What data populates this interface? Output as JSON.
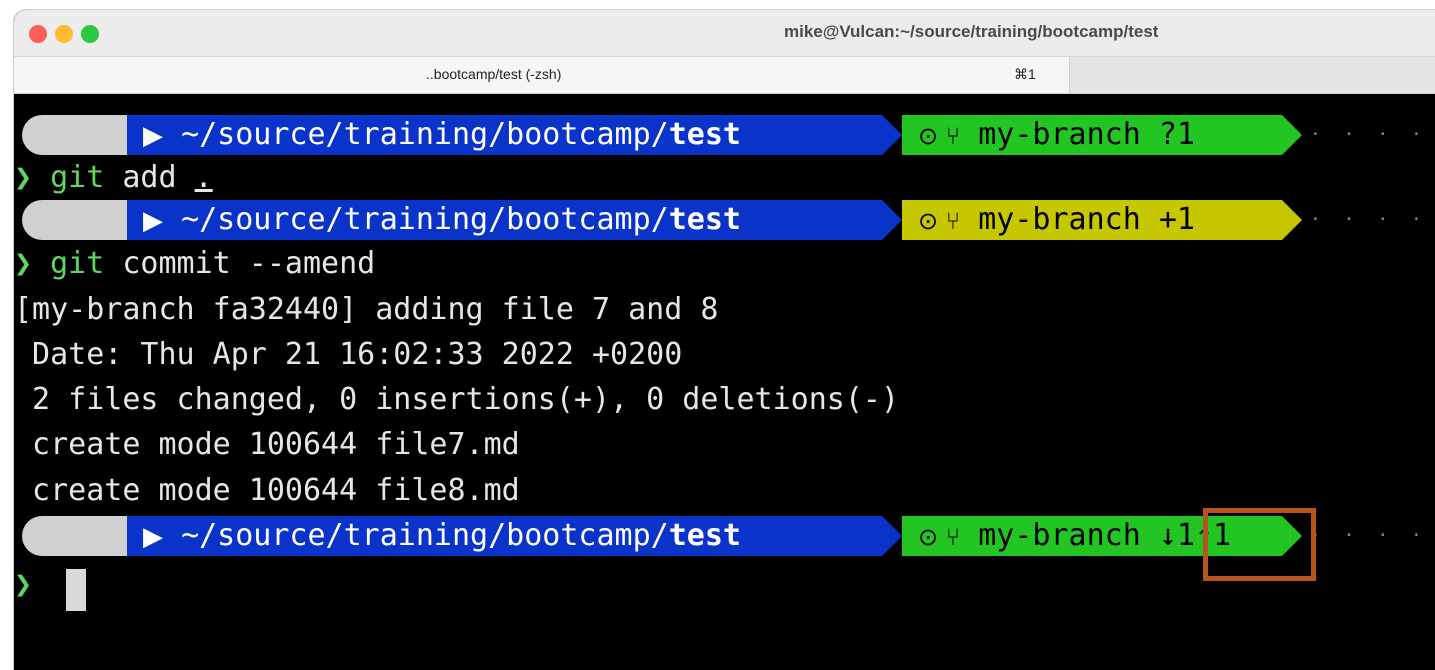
{
  "window": {
    "title": "mike@Vulcan:~/source/training/bootcamp/test",
    "tab": {
      "label": "..bootcamp/test (-zsh)",
      "shortcut": "⌘1"
    }
  },
  "terminal": {
    "prompt_char": "❯",
    "prompts": [
      {
        "os_icon": "",
        "folder_icon": "▶",
        "path": "~/source/training/bootcamp/",
        "path_bold": "test",
        "git_icon": "⊙ ⑂",
        "branch": "my-branch",
        "status": "?1",
        "color": "#22c522"
      },
      {
        "os_icon": "",
        "folder_icon": "▶",
        "path": "~/source/training/bootcamp/",
        "path_bold": "test",
        "git_icon": "⊙ ⑂",
        "branch": "my-branch",
        "status": "+1",
        "color": "#c7c700"
      },
      {
        "os_icon": "",
        "folder_icon": "▶",
        "path": "~/source/training/bootcamp/",
        "path_bold": "test",
        "git_icon": "⊙ ⑂",
        "branch": "my-branch",
        "status": "↓1↑1",
        "color": "#22c522"
      }
    ],
    "commands": [
      {
        "git": "git",
        "rest": " add ",
        "arg": "."
      },
      {
        "git": "git",
        "rest": " commit --amend",
        "arg": ""
      }
    ],
    "output": [
      "[my-branch fa32440] adding file 7 and 8",
      " Date: Thu Apr 21 16:02:33 2022 +0200",
      " 2 files changed, 0 insertions(+), 0 deletions(-)",
      " create mode 100644 file7.md",
      " create mode 100644 file8.md"
    ],
    "trail_dots": "· · · · · ·"
  },
  "colors": {
    "path_bg": "#0a33c9",
    "git_clean_bg": "#22c522",
    "git_staged_bg": "#c7c700",
    "highlight": "#b5541e"
  }
}
